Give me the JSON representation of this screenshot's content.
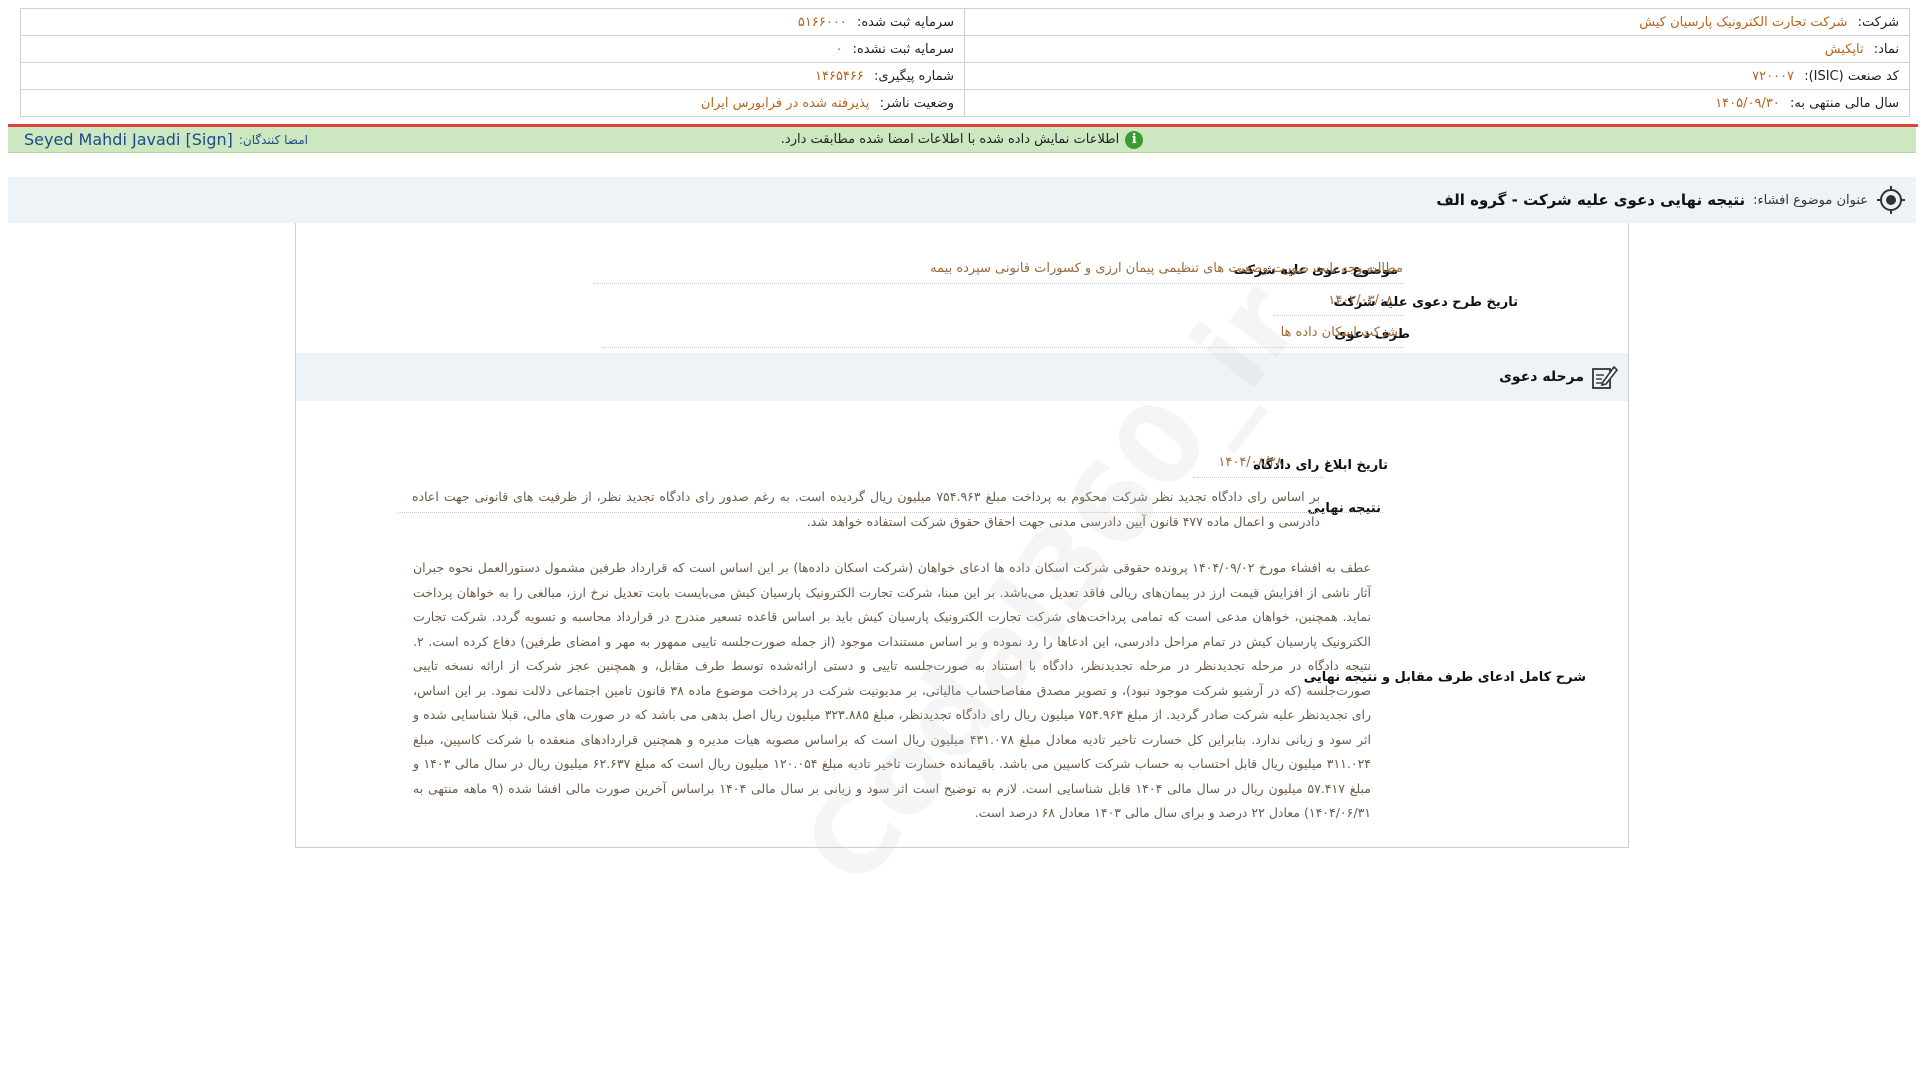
{
  "header": {
    "company_label": "شرکت:",
    "company_value": "شرکت تجارت الکترونیک پارسیان کیش",
    "symbol_label": "نماد:",
    "symbol_value": "تاپکیش",
    "isic_label": "کد صنعت (ISIC):",
    "isic_value": "۷۲۰۰۰۷",
    "fiscal_label": "سال مالی منتهی به:",
    "fiscal_value": "۱۴۰۵/۰۹/۳۰",
    "reg_capital_label": "سرمایه ثبت شده:",
    "reg_capital_value": "۵۱۶۶۰۰۰",
    "unreg_capital_label": "سرمایه ثبت نشده:",
    "unreg_capital_value": "۰",
    "tracking_label": "شماره پیگیری:",
    "tracking_value": "۱۴۶۵۴۶۶",
    "publisher_status_label": "وضعیت ناشر:",
    "publisher_status_value": "پذیرفته شده در فرابورس ایران"
  },
  "sign_bar": {
    "message": "اطلاعات نمایش داده شده با اطلاعات امضا شده مطابقت دارد.",
    "signers_label": "امضا کنندگان:",
    "signers_value": "Seyed Mahdi Javadi [Sign]"
  },
  "subject": {
    "label": "عنوان موضوع افشاء:",
    "title": "نتیجه نهایی دعوی علیه شرکت - گروه الف"
  },
  "claim": {
    "subject_label": "موضوع دعوی علیه شرکت",
    "subject_value": "مطالبه وجه بابت صورت وضعیت های تنظیمی پیمان ارزی و کسورات قانونی سپرده بیمه",
    "date_label": "تاریخ طرح دعوی علیه شرکت",
    "date_value": "۱۴۰۲/۰۳/۰۸",
    "party_label": "طرف دعوی",
    "party_value": "شرکت اسکان داده ها"
  },
  "stage": {
    "title": "مرحله دعوی",
    "ruling_date_label": "تاریخ ابلاغ رای دادگاه",
    "ruling_date_value": "۱۴۰۴/۰۸/۲۸",
    "final_result_label": "نتیجه نهایی",
    "final_result_value": "بر اساس رای دادگاه تجدید نظر شرکت محکوم به پرداخت مبلغ ۷۵۴.۹۶۳ میلیون ریال گردیده است. به رغم صدور رای دادگاه تجدید نظر، از ظرفیت های قانونی جهت اعاده دادرسی و اعمال ماده ۴۷۷ قانون آیین دادرسی مدنی جهت احقاق حقوق شرکت استفاده خواهد شد.",
    "full_desc_label": "شرح کامل ادعای طرف مقابل و نتیجه نهایی",
    "full_desc_value": "عطف به افشاء مورخ ۱۴۰۴/۰۹/۰۲ پرونده حقوقی شرکت اسکان داده ها ادعای خواهان (شرکت اسکان داده‌ها) بر این اساس است که قرارداد طرفین مشمول دستورالعمل نحوه جبران آثار ناشی از افزایش قیمت ارز در پیمان‌های ریالی فاقد تعدیل می‌باشد. بر این مبنا، شرکت تجارت الکترونیک پارسیان کیش می‌بایست بابت تعدیل نرخ ارز، مبالغی را به خواهان پرداخت نماید. همچنین، خواهان مدعی است که تمامی پرداخت‌های شرکت تجارت الکترونیک پارسیان کیش باید بر اساس قاعده تسعیر مندرج در قرارداد محاسبه و تسویه گردد. شرکت تجارت الکترونیک پارسیان کیش در تمام مراحل دادرسی، این ادعاها را رد نموده و بر اساس مستندات موجود (از جمله صورت‌جلسه تاییی ممهور به مهر و امضای طرفین) دفاع کرده است. ۲. نتیجه دادگاه در مرحله تجدیدنظر در مرحله تجدیدنظر، دادگاه با استناد به صورت‌جلسه تاییی و دستی ارائه‌شده توسط طرف مقابل، و همچنین عجز شرکت از ارائه نسخه تاییی صورت‌جلسه (که در آرشیو شرکت موجود نبود)، و تصویر مصدق مفاصاحساب مالیاتی، بر مدیونیت شرکت در پرداخت موضوع ماده ۳۸ قانون تامین اجتماعی دلالت نمود. بر این اساس، رای تجدیدنظر علیه شرکت صادر گردید. از مبلغ ۷۵۴.۹۶۳ میلیون ریال رای دادگاه تجدیدنظر، مبلغ ۳۲۳.۸۸۵ میلیون ریال اصل بدهی می باشد که در صورت های مالی، قبلا شناسایی شده و اثر سود و زیانی ندارد. بنابراین کل خسارت تاخیر تادیه معادل مبلغ ۴۳۱.۰۷۸ میلیون ریال است که براساس مصوبه هیات مدیره و همچنین قراردادهای منعقده با شرکت کاسپین، مبلغ ۳۱۱.۰۲۴ میلیون ریال قابل احتساب به حساب شرکت کاسپین می باشد. باقیمانده خسارت تاخیر تادیه مبلغ ۱۲۰.۰۵۴ میلیون ریال است که مبلغ ۶۲.۶۳۷ میلیون ریال در سال مالی ۱۴۰۳ و مبلغ ۵۷.۴۱۷ میلیون ریال در سال مالی ۱۴۰۴ قابل شناسایی است. لازم به توضیح است اثر سود و زیانی بر سال مالی ۱۴۰۴ براساس آخرین صورت مالی افشا شده (۹ ماهه منتهی به ۱۴۰۴/۰۶/۳۱) معادل ۲۲ درصد و برای سال مالی ۱۴۰۳ معادل ۶۸ درصد است."
  },
  "watermark": "Codal360_ir",
  "colors": {
    "value_text": "#b5651d",
    "sign_bar_bg": "#cde8c0",
    "header_bar_bg": "#eef3f8",
    "alert_line": "#e04040"
  }
}
